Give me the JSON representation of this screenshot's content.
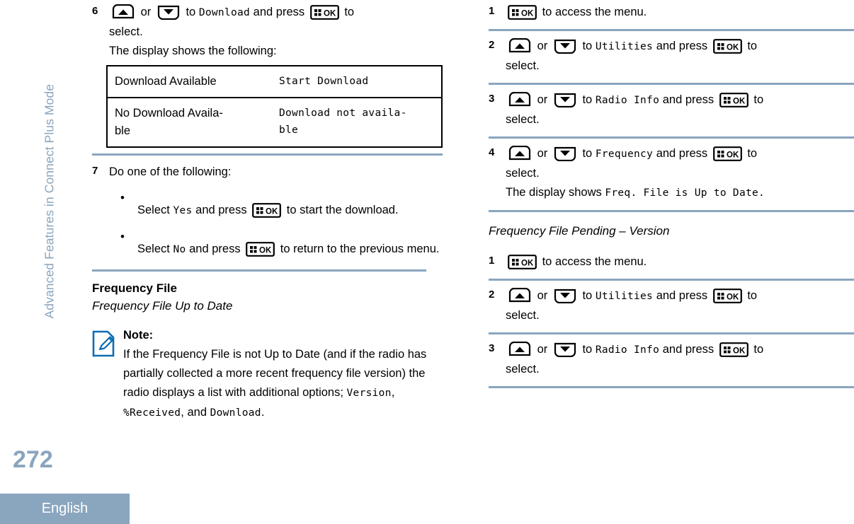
{
  "sidebar": {
    "chapter": "Advanced Features in Connect Plus Mode",
    "page_number": "272",
    "language_badge": "English",
    "accent_color": "#8AA5BE"
  },
  "icons": {
    "ok_key": "ok-key-icon",
    "up_key": "up-arrow-key-icon",
    "down_key": "down-arrow-key-icon",
    "note": "note-pencil-icon"
  },
  "left_column": {
    "step6": {
      "number": "6",
      "text_or": "or",
      "text_to": "to",
      "target": "Download",
      "text_and_press": "and press",
      "text_to_2": "to",
      "text_select": "select.",
      "followup": "The display shows the following:"
    },
    "display_table": {
      "rows": [
        {
          "label": "Download Available",
          "display": "Start Download"
        },
        {
          "label": "No Download Availa-\nble",
          "display": "Download not availa-\nble"
        }
      ]
    },
    "step7": {
      "number": "7",
      "text": "Do one of the following:",
      "bullets": [
        {
          "lead": "Select",
          "value": "Yes",
          "mid": "and press",
          "tail": "to start the download."
        },
        {
          "lead": "Select",
          "value": "No",
          "mid": "and press",
          "tail": "to return to the previous menu."
        }
      ]
    },
    "section": {
      "heading": "Frequency File",
      "subheading": "Frequency File Up to Date"
    },
    "note": {
      "title": "Note:",
      "part1": "If the Frequency File is not Up to Date (and if the radio has partially collected a more recent frequency file version) the radio displays a list with additional options;",
      "opt1": "Version",
      "sep1": ",",
      "opt2": "%Received",
      "sep2": ",",
      "and": "and",
      "opt3": "Download",
      "period": "."
    }
  },
  "right_column": {
    "group1": [
      {
        "number": "1",
        "type": "ok_only",
        "tail": "to access the menu."
      },
      {
        "number": "2",
        "type": "nav",
        "text_or": "or",
        "text_to": "to",
        "target": "Utilities",
        "text_and_press": "and press",
        "text_to_2": "to",
        "text_select": "select."
      },
      {
        "number": "3",
        "type": "nav",
        "text_or": "or",
        "text_to": "to",
        "target": "Radio Info",
        "text_and_press": "and press",
        "text_to_2": "to",
        "text_select": "select."
      },
      {
        "number": "4",
        "type": "nav",
        "text_or": "or",
        "text_to": "to",
        "target": "Frequency",
        "text_and_press": "and press",
        "text_to_2": "to",
        "text_select": "select.",
        "extra_lead": "The display shows",
        "extra_lcd": "Freq. File is Up to Date."
      }
    ],
    "section_heading": "Frequency File Pending – Version",
    "group2": [
      {
        "number": "1",
        "type": "ok_only",
        "tail": "to access the menu."
      },
      {
        "number": "2",
        "type": "nav",
        "text_or": "or",
        "text_to": "to",
        "target": "Utilities",
        "text_and_press": "and press",
        "text_to_2": "to",
        "text_select": "select."
      },
      {
        "number": "3",
        "type": "nav",
        "text_or": "or",
        "text_to": "to",
        "target": "Radio Info",
        "text_and_press": "and press",
        "text_to_2": "to",
        "text_select": "select."
      }
    ]
  }
}
